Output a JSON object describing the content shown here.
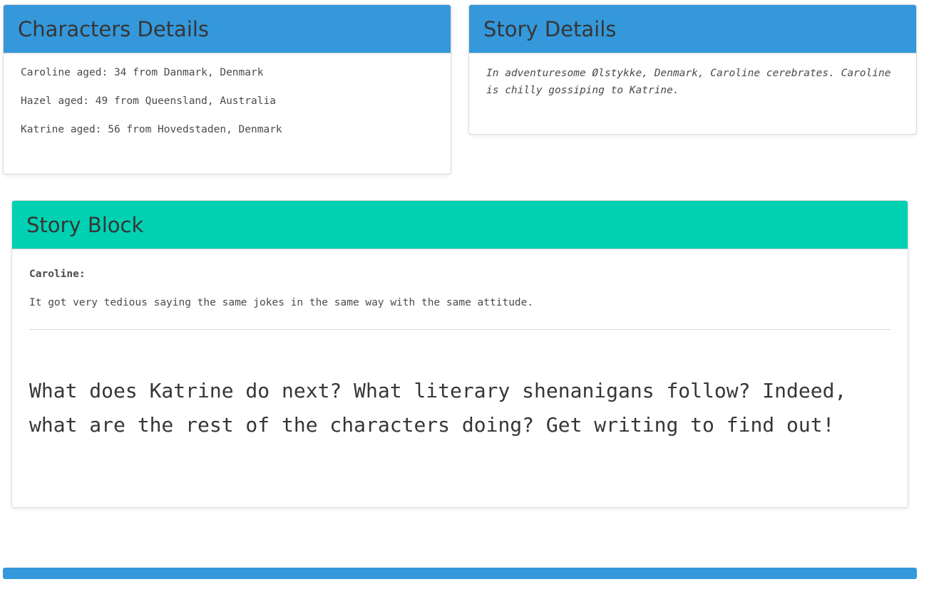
{
  "characters_panel": {
    "title": "Characters Details",
    "items": [
      "Caroline aged: 34 from Danmark, Denmark",
      "Hazel aged: 49 from Queensland, Australia",
      "Katrine aged: 56 from Hovedstaden, Denmark"
    ]
  },
  "story_details_panel": {
    "title": "Story Details",
    "text": "In adventuresome Ølstykke, Denmark, Caroline cerebrates. Caroline is chilly gossiping to Katrine."
  },
  "story_block_panel": {
    "title": "Story Block",
    "speaker": "Caroline:",
    "speech": "It got very tedious saying the same jokes in the same way with the same attitude.",
    "prompt": "What does Katrine do next? What literary shenanigans follow? Indeed, what are the rest of the characters doing? Get writing to find out!"
  },
  "colors": {
    "blue_header": "#3498db",
    "teal_header": "#00d1b2",
    "footer_bar": "#3498db"
  }
}
